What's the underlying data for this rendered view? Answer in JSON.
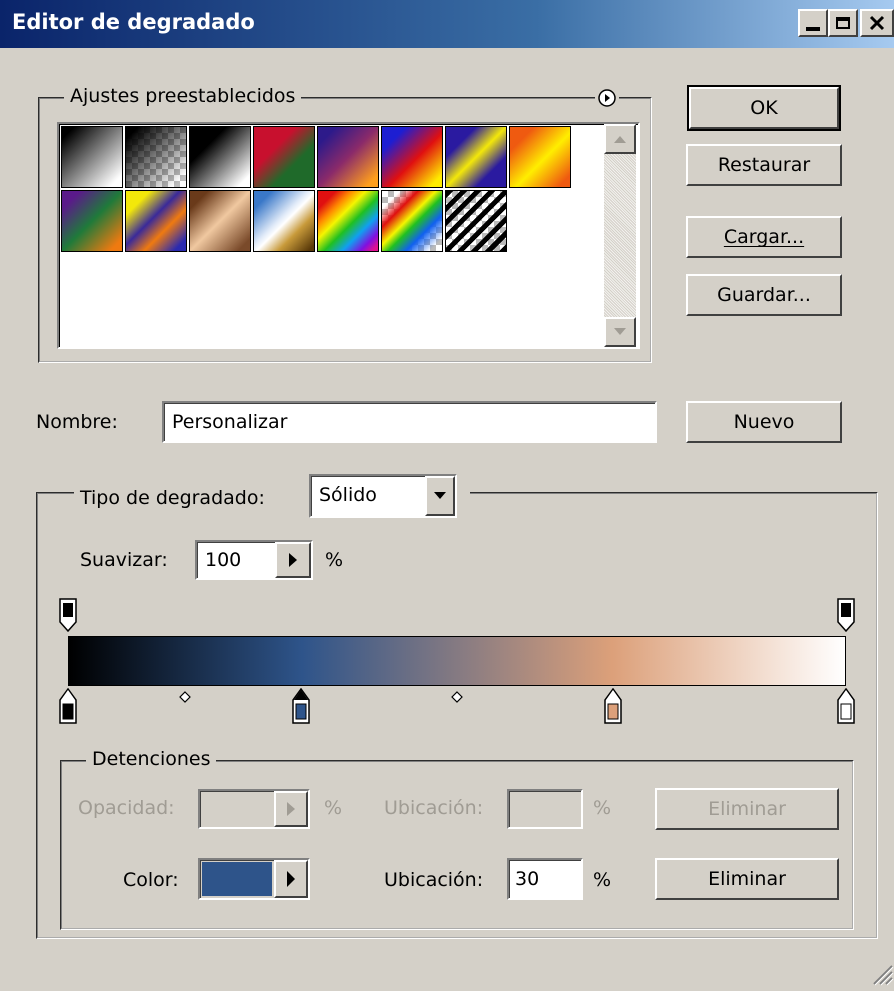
{
  "window": {
    "title": "Editor de degradado"
  },
  "presets": {
    "group_label": "Ajustes preestablecidos",
    "swatches": [
      {
        "bg": "linear-gradient(135deg,#000 10%,#fff 90%)"
      },
      {
        "bg": "linear-gradient(135deg,#000 10%,rgba(0,0,0,0) 90%)",
        "checker": true
      },
      {
        "bg": "linear-gradient(135deg,#000 30%,#fff 90%)"
      },
      {
        "bg": "linear-gradient(135deg,#c8102e 35%,#1f6a2a 65%)"
      },
      {
        "bg": "linear-gradient(135deg,#2d1a8a 15%,#8a2a6a 50%,#ff9f1c 90%)"
      },
      {
        "bg": "linear-gradient(135deg,#1d1ed2 20%,#e01010 55%,#ffec00 90%)"
      },
      {
        "bg": "linear-gradient(135deg,#2a1aa0 25%,#f3e80a 50%,#2a1aa0 75%)"
      },
      {
        "bg": "linear-gradient(135deg,#ef5a10 20%,#ffee00 55%,#ef5a10 90%)"
      },
      {
        "bg": "linear-gradient(135deg,#5a1a8a 15%,#1f7a3a 50%,#ef7a10 90%)"
      },
      {
        "bg": "linear-gradient(135deg,#f3e80a 20%,#3a2a9a 45%,#ef7a10 65%,#2a2ab0 90%)"
      },
      {
        "bg": "linear-gradient(135deg,#6a3a1a 15%,#f0c8a0 50%,#7a4a2a 90%)"
      },
      {
        "bg": "linear-gradient(135deg,#3a78c8 15%,#e0eaf8 45%,#fff 52%,#c89a3a 70%,#5a3a0a 95%)"
      },
      {
        "bg": "linear-gradient(135deg,#e01010 15%,#ff8a00 28%,#f5f500 40%,#20c020 55%,#10a0f0 70%,#8010e0 85%,#e01090 95%)"
      },
      {
        "bg": "linear-gradient(135deg,rgba(0,0,0,0) 15%,#e01010 30%,#f5f500 45%,#20c020 55%,#1060f0 70%,rgba(0,0,0,0) 90%)",
        "checker": true
      },
      {
        "bg": "repeating-linear-gradient(135deg,#000 0 5px,rgba(0,0,0,0) 5px 10px)",
        "checker": true
      }
    ]
  },
  "buttons": {
    "ok": "OK",
    "restore": "Restaurar",
    "load": "Cargar...",
    "save": "Guardar...",
    "new": "Nuevo"
  },
  "name_field": {
    "label": "Nombre:",
    "value": "Personalizar"
  },
  "gradient_type": {
    "label": "Tipo de degradado:",
    "value": "Sólido"
  },
  "smooth": {
    "label": "Suavizar:",
    "value": "100",
    "unit": "%"
  },
  "stops": {
    "group_label": "Detenciones",
    "opacity_label": "Opacidad:",
    "opacity_value": "",
    "percent": "%",
    "location_label": "Ubicación:",
    "location_opacity_value": "",
    "delete_label": "Eliminar",
    "color_label": "Color:",
    "color_value": "#2e548a",
    "location_color_value": "30"
  },
  "gradient": {
    "color_stops": [
      {
        "location": 0,
        "color": "#000000",
        "selected": false
      },
      {
        "location": 30,
        "color": "#2e548a",
        "selected": true
      },
      {
        "location": 70,
        "color": "#dca07a",
        "selected": false
      },
      {
        "location": 100,
        "color": "#ffffff",
        "selected": false
      }
    ],
    "opacity_stops": [
      0,
      100
    ],
    "midpoints": [
      15,
      50
    ]
  }
}
